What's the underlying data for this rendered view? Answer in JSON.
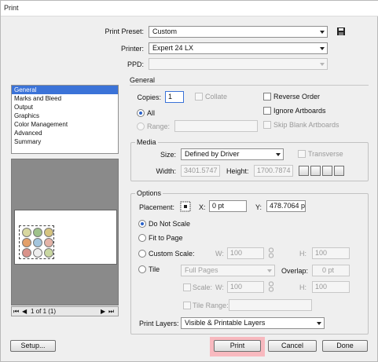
{
  "window": {
    "title": "Print"
  },
  "top": {
    "preset_label": "Print Preset:",
    "preset_value": "Custom",
    "printer_label": "Printer:",
    "printer_value": "Expert 24 LX",
    "ppd_label": "PPD:",
    "ppd_value": ""
  },
  "sidebar": {
    "items": [
      {
        "label": "General",
        "selected": true
      },
      {
        "label": "Marks and Bleed"
      },
      {
        "label": "Output"
      },
      {
        "label": "Graphics"
      },
      {
        "label": "Color Management"
      },
      {
        "label": "Advanced"
      },
      {
        "label": "Summary"
      }
    ]
  },
  "preview": {
    "page_nav": "1 of 1 (1)"
  },
  "general": {
    "title": "General",
    "copies_label": "Copies:",
    "copies_value": "1",
    "collate_label": "Collate",
    "reverse_order_label": "Reverse Order",
    "all_label": "All",
    "range_label": "Range:",
    "range_value": "",
    "ignore_artboards_label": "Ignore Artboards",
    "skip_blank_label": "Skip Blank Artboards"
  },
  "media": {
    "title": "Media",
    "size_label": "Size:",
    "size_value": "Defined by Driver",
    "transverse_label": "Transverse",
    "width_label": "Width:",
    "width_value": "3401.5747",
    "height_label": "Height:",
    "height_value": "1700.7874"
  },
  "options": {
    "title": "Options",
    "placement_label": "Placement:",
    "x_label": "X:",
    "x_value": "0 pt",
    "y_label": "Y:",
    "y_value": "478.7064 p",
    "do_not_scale_label": "Do Not Scale",
    "fit_to_page_label": "Fit to Page",
    "custom_scale_label": "Custom Scale:",
    "w_label": "W:",
    "w_value": "100",
    "h_label": "H:",
    "h_value": "100",
    "tile_label": "Tile",
    "tile_value": "Full Pages",
    "overlap_label": "Overlap:",
    "overlap_value": "0 pt",
    "scale_label": "Scale:",
    "scale_w_label": "W:",
    "scale_w_value": "100",
    "scale_h_label": "H:",
    "scale_h_value": "100",
    "tile_range_label": "Tile Range:",
    "tile_range_value": "",
    "print_layers_label": "Print Layers:",
    "print_layers_value": "Visible & Printable Layers"
  },
  "buttons": {
    "setup": "Setup...",
    "print": "Print",
    "cancel": "Cancel",
    "done": "Done"
  },
  "colors": {
    "print_highlight": "#f8b9bf",
    "selection": "#3b73d8"
  }
}
